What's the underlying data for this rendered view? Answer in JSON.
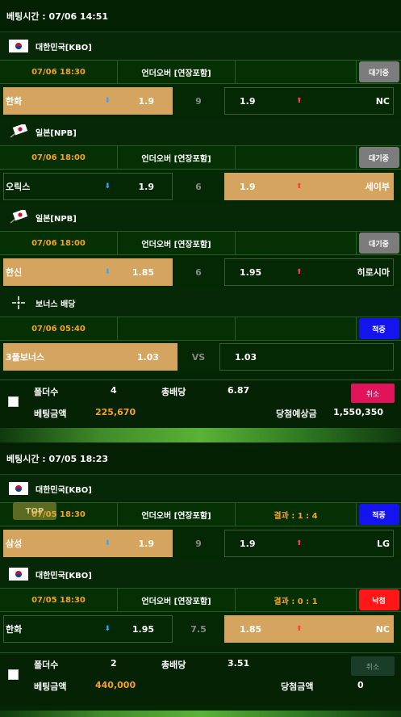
{
  "tickets": [
    {
      "header": "베팅시간 : 07/06 14:51",
      "games": [
        {
          "league": "대한민국[KBO]",
          "time": "07/06 18:30",
          "kind": "언더오버 [연장포함]",
          "result": "",
          "status": "대기중",
          "home": "한화",
          "home_odds": "1.9",
          "line": "9",
          "away_odds": "1.9",
          "away": "NC",
          "selected": "home"
        },
        {
          "league": "일본[NPB]",
          "time": "07/06 18:00",
          "kind": "언더오버 [연장포함]",
          "result": "",
          "status": "대기중",
          "home": "오릭스",
          "home_odds": "1.9",
          "line": "6",
          "away_odds": "1.9",
          "away": "세이부",
          "selected": "away"
        },
        {
          "league": "일본[NPB]",
          "time": "07/06 18:00",
          "kind": "언더오버 [연장포함]",
          "result": "",
          "status": "대기중",
          "home": "한신",
          "home_odds": "1.85",
          "line": "6",
          "away_odds": "1.95",
          "away": "히로시마",
          "selected": "home"
        },
        {
          "league": "보너스 배당",
          "time": "07/06 05:40",
          "kind": "",
          "result": "",
          "status": "적중",
          "home": "3폴보너스",
          "home_odds": "1.03",
          "line": "VS",
          "away_odds": "1.03",
          "away": "",
          "selected": "home"
        }
      ],
      "foot": {
        "folders_label": "폴더수",
        "folders": "4",
        "total_label": "총배당",
        "total": "6.87",
        "bet_label": "베팅금액",
        "bet": "225,670",
        "win_label": "당첨예상금",
        "win": "1,550,350",
        "cancel": "취소"
      }
    },
    {
      "header": "베팅시간 : 07/05 18:23",
      "games": [
        {
          "league": "대한민국[KBO]",
          "time": "07/05 18:30",
          "kind": "언더오버 [연장포함]",
          "result": "결과 : 1 : 4",
          "status": "적중",
          "home": "삼성",
          "home_odds": "1.9",
          "line": "9",
          "away_odds": "1.9",
          "away": "LG",
          "selected": "home"
        },
        {
          "league": "대한민국[KBO]",
          "time": "07/05 18:30",
          "kind": "언더오버 [연장포함]",
          "result": "결과 : 0 : 1",
          "status": "낙첨",
          "home": "한화",
          "home_odds": "1.95",
          "line": "7.5",
          "away_odds": "1.85",
          "away": "NC",
          "selected": "away"
        }
      ],
      "foot": {
        "folders_label": "폴더수",
        "folders": "2",
        "total_label": "총배당",
        "total": "3.51",
        "bet_label": "베팅금액",
        "bet": "440,000",
        "win_label": "당첨금액",
        "win": "0",
        "cancel": "취소"
      }
    }
  ],
  "top_button": "TOP",
  "colors": {
    "accent": "#f7a21b",
    "selected": "#d5a560",
    "hit": "#1414ee",
    "miss": "#ff1616",
    "wait": "#7c7c7c",
    "cancel_active": "#e0145a"
  }
}
